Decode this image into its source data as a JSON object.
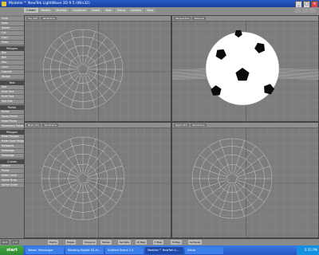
{
  "window": {
    "title": "Modeler™ NewTek LightWave 3D 9.5 (Win32)",
    "controls": [
      "_",
      "□",
      "×"
    ]
  },
  "menubar": {
    "tabs": [
      "Create",
      "Modify",
      "Multiply",
      "Construct",
      "Detail",
      "Map",
      "Setup",
      "Utilities",
      "View"
    ],
    "active_tab_index": 0
  },
  "sidebar": {
    "sections": [
      {
        "header": "",
        "items": [
          "Undo",
          "Redo",
          "Delete",
          "Cut",
          "Copy",
          "Paste"
        ]
      },
      {
        "header": "Polygon",
        "items": [
          "Box",
          "Ball",
          "Disc",
          "Cone",
          "Capsule",
          "Wedge"
        ]
      },
      {
        "header": "Text",
        "items": [
          "Text",
          "Multi Text",
          "Multi Text",
          "Text Edit"
        ]
      },
      {
        "header": "Points",
        "items": [
          "Points",
          "Spray Points",
          "Make Points",
          "Parametric Points"
        ]
      },
      {
        "header": "Polygon",
        "items": [
          "Make Polygon",
          "Make Open Polygon",
          "Metaballs",
          "Metaedge",
          "Metaedge"
        ]
      },
      {
        "header": "Curves",
        "items": [
          "Sketch",
          "Points",
          "Make Curve",
          "Spline Draw",
          "Spline Guide"
        ]
      }
    ]
  },
  "viewports": [
    {
      "id": "top",
      "projection": "Top (XZ)",
      "shading": "Wireframe"
    },
    {
      "id": "perspective",
      "projection": "Perspective",
      "shading": "Textured"
    },
    {
      "id": "back",
      "projection": "Back (XY)",
      "shading": "Wireframe"
    },
    {
      "id": "right",
      "projection": "Right (ZY)",
      "shading": "Wireframe"
    }
  ],
  "status": {
    "grid": "Grid",
    "value": "1 m",
    "buttons": [
      "Points",
      "Edges",
      "Polygons",
      "Modes",
      "Sel Sets",
      "W Map",
      "T Map",
      "M Map",
      "Surfaces"
    ]
  },
  "taskbar": {
    "start_label": "start",
    "items": [
      {
        "label": "Yahoo! Messenger",
        "active": false
      },
      {
        "label": "Rotating Digital 3D Ar...",
        "active": false
      },
      {
        "label": "Untitled Scene 1.0",
        "active": false
      },
      {
        "label": "Modeler™ NewTek LI...",
        "active": true
      },
      {
        "label": "Setup",
        "active": false
      }
    ],
    "clock": "5:35 PM"
  },
  "colors": {
    "ball_white": "#ffffff",
    "ball_black": "#0a0a0a",
    "wireframe": "#e8e8e8",
    "grid": "#8e8e8e"
  }
}
